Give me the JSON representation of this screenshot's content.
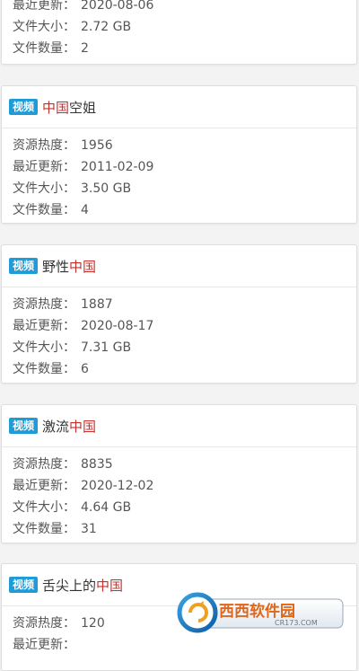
{
  "labels": {
    "heat": "资源热度：",
    "updated": "最近更新：",
    "size": "文件大小：",
    "count": "文件数量："
  },
  "cards": [
    {
      "badge": "",
      "title_parts": [],
      "heat": "",
      "updated": "2020-08-06",
      "size": "2.72 GB",
      "count": "2"
    },
    {
      "badge": "视频",
      "title_parts": [
        {
          "text": "中国",
          "hl": true
        },
        {
          "text": "空姐",
          "hl": false
        }
      ],
      "heat": "1956",
      "updated": "2011-02-09",
      "size": "3.50 GB",
      "count": "4"
    },
    {
      "badge": "视频",
      "title_parts": [
        {
          "text": "野性",
          "hl": false
        },
        {
          "text": "中国",
          "hl": true
        }
      ],
      "heat": "1887",
      "updated": "2020-08-17",
      "size": "7.31 GB",
      "count": "6"
    },
    {
      "badge": "视频",
      "title_parts": [
        {
          "text": "激流",
          "hl": false
        },
        {
          "text": "中国",
          "hl": true
        }
      ],
      "heat": "8835",
      "updated": "2020-12-02",
      "size": "4.64 GB",
      "count": "31"
    },
    {
      "badge": "视频",
      "title_parts": [
        {
          "text": "舌尖上的",
          "hl": false
        },
        {
          "text": "中国",
          "hl": true
        }
      ],
      "heat": "120",
      "updated": "",
      "size": "",
      "count": ""
    }
  ],
  "watermark": {
    "logo_text": "西西软件园",
    "logo_sub": "CR173.COM",
    "icon": "cr-logo-icon"
  },
  "colors": {
    "badge": "#1f9bd8",
    "highlight": "#c9302c",
    "card_bg": "#ffffff",
    "page_bg": "#f3f3f3"
  }
}
